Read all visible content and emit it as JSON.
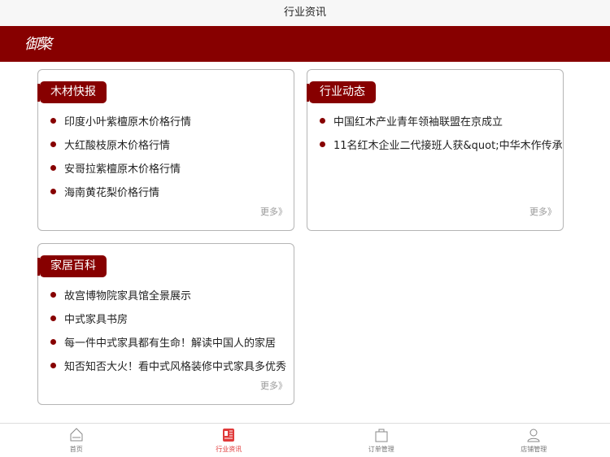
{
  "header": {
    "title": "行业资讯",
    "logo_text": "御檠"
  },
  "colors": {
    "brand": "#870000",
    "active_tab": "#e03a3a"
  },
  "cards": [
    {
      "tag": "木材快报",
      "items": [
        "印度小叶紫檀原木价格行情",
        "大红酸枝原木价格行情",
        "安哥拉紫檀原木价格行情",
        "海南黄花梨价格行情"
      ],
      "more": "更多》"
    },
    {
      "tag": "行业动态",
      "items": [
        "中国红木产业青年领袖联盟在京成立",
        "11名红木企业二代接班人获&quot;中华木作传承"
      ],
      "more": "更多》"
    },
    {
      "tag": "家居百科",
      "items": [
        "故宫博物院家具馆全景展示",
        "中式家具书房",
        "每一件中式家具都有生命！解读中国人的家居",
        "知否知否大火！看中式风格装修中式家具多优秀"
      ],
      "more": "更多》"
    }
  ],
  "tabs": [
    {
      "label": "首页",
      "icon": "home-icon"
    },
    {
      "label": "行业资讯",
      "icon": "news-icon",
      "active": true
    },
    {
      "label": "订单管理",
      "icon": "bag-icon"
    },
    {
      "label": "店铺管理",
      "icon": "user-icon"
    }
  ]
}
